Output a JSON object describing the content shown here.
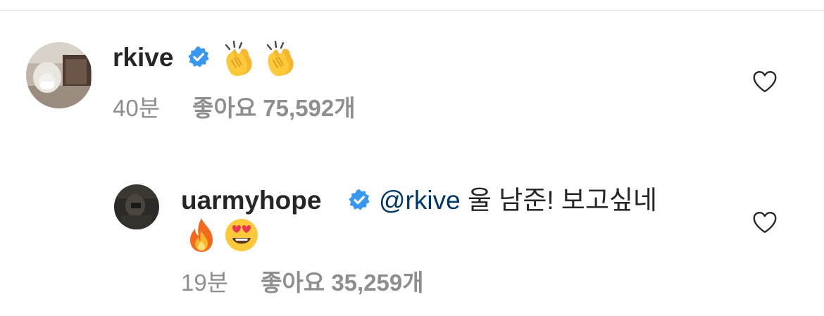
{
  "comments": [
    {
      "username": "rkive",
      "text": "",
      "emojis": [
        "clapping-hands",
        "clapping-hands"
      ],
      "time": "40분",
      "likes": "좋아요 75,592개"
    },
    {
      "username": "uarmyhope",
      "mention": "@rkive",
      "text": "울 남준! 보고싶네",
      "emojis": [
        "fire",
        "heart-eyes-face"
      ],
      "time": "19분",
      "likes": "좋아요 35,259개"
    }
  ],
  "colors": {
    "verified": "#3897f0",
    "mention": "#00376b",
    "meta": "#8e8e8e",
    "text": "#262626",
    "divider": "#dbdbdb"
  }
}
